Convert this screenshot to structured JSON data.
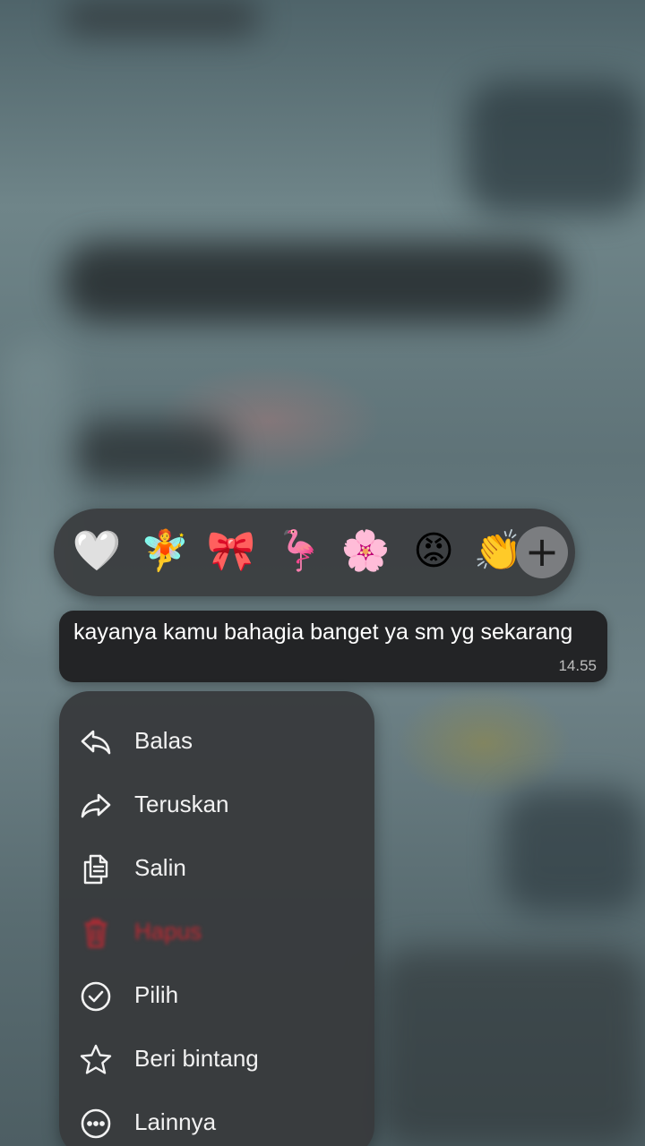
{
  "reactions": {
    "emojis": [
      {
        "icon": "white-heart-icon",
        "glyph": "🤍"
      },
      {
        "icon": "fairy-icon",
        "glyph": "🧚"
      },
      {
        "icon": "ribbon-icon",
        "glyph": "🎀"
      },
      {
        "icon": "flamingo-icon",
        "glyph": "🦩"
      },
      {
        "icon": "cherry-blossom-icon",
        "glyph": "🌸"
      },
      {
        "icon": "angry-face-icon",
        "glyph": "😡"
      },
      {
        "icon": "clapping-hands-icon",
        "glyph": "👏"
      }
    ],
    "more_glyph": "+"
  },
  "message": {
    "text": "kayanya kamu bahagia banget ya sm yg sekarang",
    "time": "14.55"
  },
  "menu": {
    "items": [
      {
        "label": "Balas",
        "icon": "reply-icon"
      },
      {
        "label": "Teruskan",
        "icon": "forward-icon"
      },
      {
        "label": "Salin",
        "icon": "copy-icon"
      },
      {
        "label": "Hapus",
        "icon": "trash-icon"
      },
      {
        "label": "Pilih",
        "icon": "check-circle-icon"
      },
      {
        "label": "Beri bintang",
        "icon": "star-icon"
      },
      {
        "label": "Lainnya",
        "icon": "more-circle-icon"
      }
    ]
  },
  "colors": {
    "menu_background": "#383a3c",
    "bubble_background": "#232426",
    "danger": "#c62832",
    "text": "#f2f2f2"
  }
}
